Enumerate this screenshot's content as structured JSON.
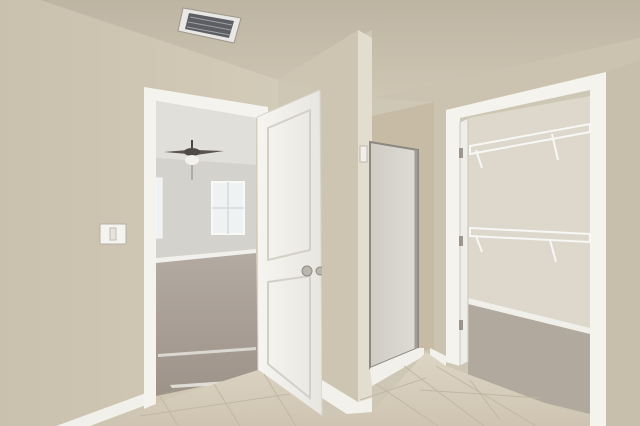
{
  "scene": {
    "subject": "interior-hallway",
    "visible_text": []
  },
  "colors": {
    "wall": "#cbc3af",
    "wall_shadow": "#b9b19d",
    "ceiling": "#c8c0ad",
    "trim": "#f3f1ec",
    "carpet": "#a79b90",
    "tile": "#d9d0bf",
    "shower_glass": "#d8d6cf",
    "window": "#e9eef0"
  }
}
